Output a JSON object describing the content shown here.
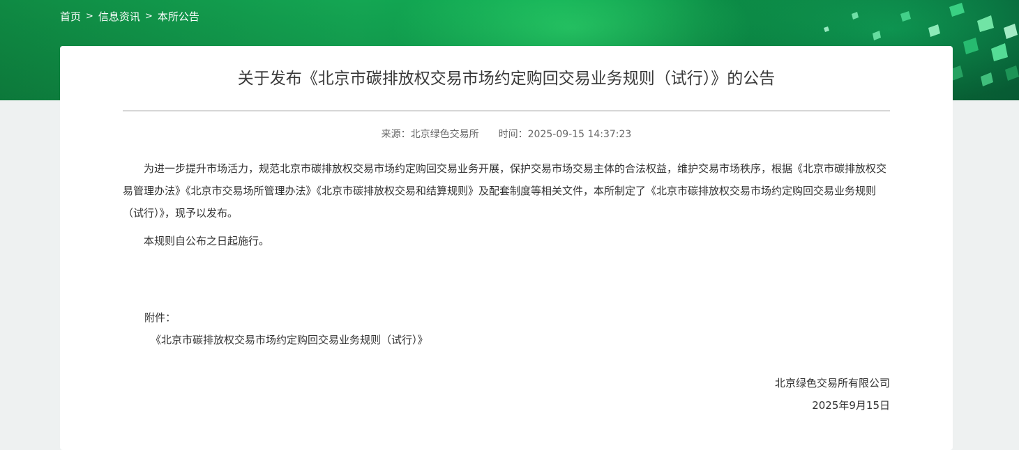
{
  "breadcrumb": {
    "home": "首页",
    "news": "信息资讯",
    "current": "本所公告",
    "separator": ">"
  },
  "article": {
    "title": "关于发布《北京市碳排放权交易市场约定购回交易业务规则（试行）》的公告",
    "source_label": "来源：",
    "source_value": "北京绿色交易所",
    "time_label": "时间：",
    "time_value": "2025-09-15 14:37:23",
    "paragraphs": [
      "为进一步提升市场活力，规范北京市碳排放权交易市场约定购回交易业务开展，保护交易市场交易主体的合法权益，维护交易市场秩序，根据《北京市碳排放权交易管理办法》《北京市交易场所管理办法》《北京市碳排放权交易和结算规则》及配套制度等相关文件，本所制定了《北京市碳排放权交易市场约定购回交易业务规则（试行）》，现予以发布。",
      "本规则自公布之日起施行。"
    ],
    "attachment_label": "附件：",
    "attachment_link": "《北京市碳排放权交易市场约定购回交易业务规则（试行）》",
    "signature_org": "北京绿色交易所有限公司",
    "signature_date": "2025年9月15日"
  },
  "colors": {
    "banner_green": "#14a653",
    "page_background": "#eef1f1",
    "card_background": "#ffffff",
    "title_text": "#3a3a3a",
    "body_text": "#333333",
    "meta_text": "#666666"
  },
  "icons": {
    "banner_decoration": "green-cubes-decoration"
  }
}
